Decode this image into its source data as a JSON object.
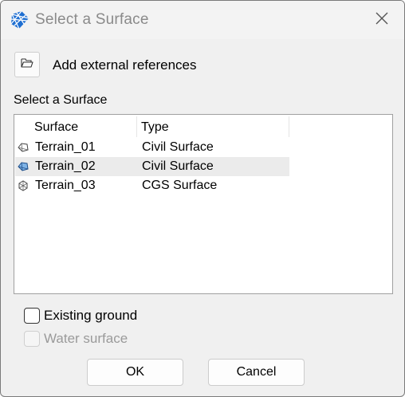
{
  "window": {
    "title": "Select a Surface",
    "app_icon": "surface-grid-icon",
    "close_icon": "close-icon"
  },
  "toolbar": {
    "add_reference_icon": "open-folder-icon",
    "add_reference_label": "Add external references"
  },
  "surface_section": {
    "label": "Select a Surface",
    "columns": [
      "Surface",
      "Type"
    ],
    "rows": [
      {
        "surface": "Terrain_01",
        "type": "Civil Surface",
        "icon": "civil-surface-icon",
        "selected": false
      },
      {
        "surface": "Terrain_02",
        "type": "Civil Surface",
        "icon": "civil-surface-icon",
        "selected": true
      },
      {
        "surface": "Terrain_03",
        "type": "CGS Surface",
        "icon": "cgs-surface-icon",
        "selected": false
      }
    ]
  },
  "options": {
    "existing_ground": {
      "label": "Existing ground",
      "checked": false,
      "enabled": true
    },
    "water_surface": {
      "label": "Water surface",
      "checked": false,
      "enabled": false
    }
  },
  "buttons": {
    "ok": "OK",
    "cancel": "Cancel"
  },
  "colors": {
    "app_icon_blue": "#1f6fd1",
    "selected_row": "#ebebeb",
    "disabled_text": "#9a9a9a"
  }
}
